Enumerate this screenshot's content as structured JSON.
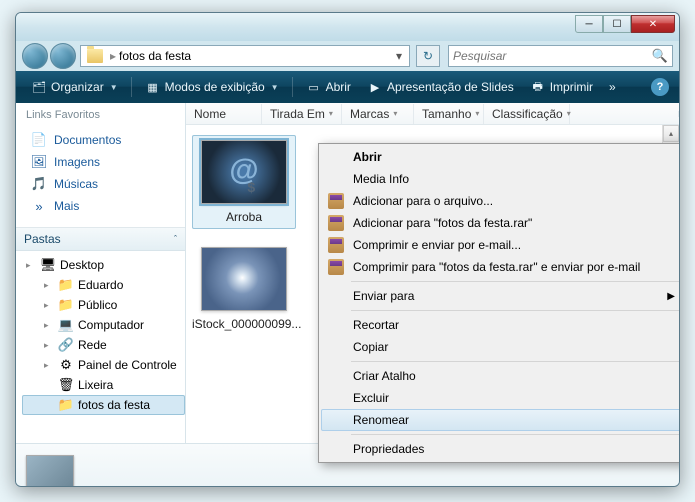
{
  "window": {
    "title": "fotos da festa"
  },
  "address": {
    "path": "fotos da festa"
  },
  "search": {
    "placeholder": "Pesquisar"
  },
  "toolbar": {
    "organize": "Organizar",
    "views": "Modos de exibição",
    "open": "Abrir",
    "slideshow": "Apresentação de Slides",
    "print": "Imprimir",
    "more": "»"
  },
  "sidebar": {
    "fav_header": "Links Favoritos",
    "favs": [
      {
        "icon": "📄",
        "label": "Documentos"
      },
      {
        "icon": "🖼",
        "label": "Imagens"
      },
      {
        "icon": "🎵",
        "label": "Músicas"
      },
      {
        "icon": "»",
        "label": "Mais"
      }
    ],
    "folders_header": "Pastas",
    "tree": [
      {
        "icon": "🖥",
        "label": "Desktop",
        "indent": 0,
        "arrow": "▸"
      },
      {
        "icon": "📁",
        "label": "Eduardo",
        "indent": 1,
        "arrow": "▸"
      },
      {
        "icon": "📁",
        "label": "Público",
        "indent": 1,
        "arrow": "▸"
      },
      {
        "icon": "💻",
        "label": "Computador",
        "indent": 1,
        "arrow": "▸"
      },
      {
        "icon": "🔗",
        "label": "Rede",
        "indent": 1,
        "arrow": "▸"
      },
      {
        "icon": "⚙",
        "label": "Painel de Controle",
        "indent": 1,
        "arrow": "▸"
      },
      {
        "icon": "🗑",
        "label": "Lixeira",
        "indent": 1,
        "arrow": ""
      },
      {
        "icon": "📁",
        "label": "fotos da festa",
        "indent": 1,
        "arrow": "",
        "selected": true
      }
    ]
  },
  "columns": [
    {
      "label": "Nome",
      "width": 76,
      "sorted": true
    },
    {
      "label": "Tirada Em",
      "width": 80
    },
    {
      "label": "Marcas",
      "width": 72
    },
    {
      "label": "Tamanho",
      "width": 70
    },
    {
      "label": "Classificação",
      "width": 86
    }
  ],
  "thumbs": [
    {
      "label": "Arroba",
      "img": "arroba",
      "selected": true
    },
    {
      "label": "iStock_000000099...",
      "img": "istock",
      "selected": false
    }
  ],
  "context_menu": {
    "groups": [
      [
        {
          "label": "Abrir",
          "bold": true
        },
        {
          "label": "Media Info"
        },
        {
          "label": "Adicionar para o arquivo...",
          "icon": "rar"
        },
        {
          "label": "Adicionar para \"fotos da festa.rar\"",
          "icon": "rar"
        },
        {
          "label": "Comprimir e enviar por e-mail...",
          "icon": "rar"
        },
        {
          "label": "Comprimir para \"fotos da festa.rar\" e enviar por e-mail",
          "icon": "rar"
        }
      ],
      [
        {
          "label": "Enviar para",
          "submenu": true
        }
      ],
      [
        {
          "label": "Recortar"
        },
        {
          "label": "Copiar"
        }
      ],
      [
        {
          "label": "Criar Atalho"
        },
        {
          "label": "Excluir"
        },
        {
          "label": "Renomear",
          "hover": true
        }
      ],
      [
        {
          "label": "Propriedades"
        }
      ]
    ]
  }
}
